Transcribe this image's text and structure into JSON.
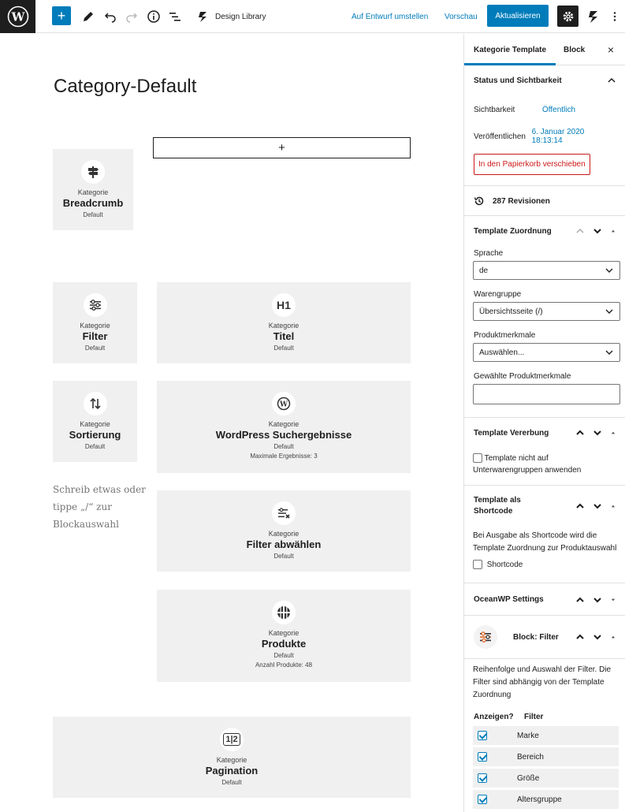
{
  "toolbar": {
    "design_library_label": "Design Library",
    "save_draft_label": "Auf Entwurf umstellen",
    "preview_label": "Vorschau",
    "update_label": "Aktualisieren"
  },
  "editor": {
    "page_title": "Category-Default",
    "appender_symbol": "+",
    "placeholder": "Schreib etwas oder tippe „/“ zur Blockauswahl",
    "blocks": [
      {
        "kat": "Kategorie",
        "name": "Breadcrumb",
        "default": "Default",
        "extra": "",
        "icon": "signpost-icon"
      },
      {
        "kat": "Kategorie",
        "name": "Filter",
        "default": "Default",
        "extra": "",
        "icon": "sliders-icon"
      },
      {
        "kat": "Kategorie",
        "name": "Titel",
        "default": "Default",
        "extra": "",
        "icon": "heading-icon"
      },
      {
        "kat": "Kategorie",
        "name": "Sortierung",
        "default": "Default",
        "extra": "",
        "icon": "sort-arrows-icon"
      },
      {
        "kat": "Kategorie",
        "name": "WordPress Suchergebnisse",
        "default": "Default",
        "extra": "Maximale Ergebnisse: 3",
        "icon": "wordpress-icon"
      },
      {
        "kat": "Kategorie",
        "name": "Filter abwählen",
        "default": "Default",
        "extra": "",
        "icon": "filter-remove-icon"
      },
      {
        "kat": "Kategorie",
        "name": "Produkte",
        "default": "Default",
        "extra": "Anzahl Produkte: 48",
        "icon": "grid-icon"
      },
      {
        "kat": "Kategorie",
        "name": "Pagination",
        "default": "Default",
        "extra": "",
        "icon": "pagination-icon"
      }
    ],
    "heading_icon_text": "H1",
    "pagination_icon_text": "1|2"
  },
  "sidebar": {
    "tabs": [
      "Kategorie Template",
      "Block"
    ],
    "close_symbol": "×",
    "status": {
      "title": "Status und Sichtbarkeit",
      "visibility_label": "Sichtbarkeit",
      "visibility_value": "Öffentlich",
      "publish_label": "Veröffentlichen",
      "publish_value": "6. Januar 2020 18:13:14",
      "trash_label": "In den Papierkorb verschieben"
    },
    "revisions": "287 Revisionen",
    "assignment": {
      "title": "Template Zuordnung",
      "language_label": "Sprache",
      "language_value": "de",
      "group_label": "Warengruppe",
      "group_value": "Übersichtsseite (/)",
      "features_label": "Produktmerkmale",
      "features_value": "Auswählen...",
      "chosen_label": "Gewählte Produktmerkmale"
    },
    "inheritance": {
      "title": "Template Vererbung",
      "checkbox_label": "Template nicht auf Unterwarengruppen anwenden"
    },
    "shortcode": {
      "title": "Template als Shortcode",
      "description": "Bei Ausgabe als Shortcode wird die Template Zuordnung zur Produktauswahl",
      "checkbox_label": "Shortcode"
    },
    "oceanwp": {
      "title": "OceanWP Settings"
    },
    "block_filter": {
      "title": "Block: Filter",
      "description": "Reihenfolge und Auswahl der Filter. Die Filter sind abhängig von der Template Zuordnung",
      "col_show": "Anzeigen?",
      "col_filter": "Filter",
      "rows": [
        {
          "label": "Marke",
          "checked": true
        },
        {
          "label": "Bereich",
          "checked": true
        },
        {
          "label": "Größe",
          "checked": true
        },
        {
          "label": "Altersgruppe",
          "checked": true
        }
      ]
    }
  }
}
